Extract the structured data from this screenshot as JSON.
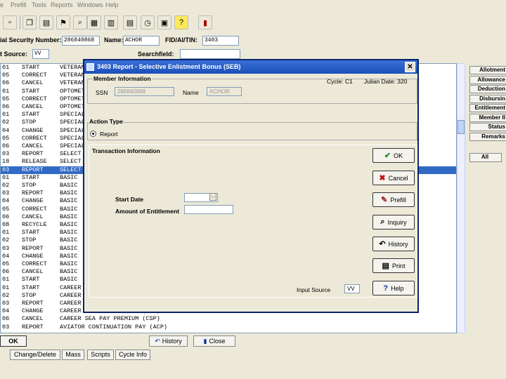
{
  "menu": [
    "e",
    "Prefill",
    "Tools",
    "Reports",
    "Windows",
    "Help"
  ],
  "toolbar_icons": [
    "new-icon",
    "copy-icon",
    "paste-icon",
    "flag-icon",
    "find-icon",
    "calculator-icon",
    "report-icon",
    "clock-icon",
    "help-icon",
    "exit-icon"
  ],
  "fields": {
    "ssn_label": "ial Security Number:",
    "ssn_value": "286840868",
    "name_label": "Name:",
    "name_value": "ACHOR",
    "fid_label": "FID/AI/TIN:",
    "fid_value": "3403",
    "input_source_label": "t Source:",
    "input_source_value": "VV",
    "searchfield_label": "Searchfield:",
    "searchfield_value": ""
  },
  "rows": [
    {
      "c1": "01",
      "c2": "START",
      "c3": "VETERAN"
    },
    {
      "c1": "05",
      "c2": "CORRECT",
      "c3": "VETERAN"
    },
    {
      "c1": "06",
      "c2": "CANCEL",
      "c3": "VETERAN"
    },
    {
      "c1": "01",
      "c2": "START",
      "c3": "OPTOMETRIST"
    },
    {
      "c1": "05",
      "c2": "CORRECT",
      "c3": "OPTOMETRIST"
    },
    {
      "c1": "06",
      "c2": "CANCEL",
      "c3": "OPTOMETRIST"
    },
    {
      "c1": "01",
      "c2": "START",
      "c3": "SPECIAL"
    },
    {
      "c1": "02",
      "c2": "STOP",
      "c3": "SPECIAL"
    },
    {
      "c1": "04",
      "c2": "CHANGE",
      "c3": "SPECIAL"
    },
    {
      "c1": "05",
      "c2": "CORRECT",
      "c3": "SPECIAL"
    },
    {
      "c1": "06",
      "c2": "CANCEL",
      "c3": "SPECIAL"
    },
    {
      "c1": "03",
      "c2": "REPORT",
      "c3": "SELECT"
    },
    {
      "c1": "18",
      "c2": "RELEASE",
      "c3": "SELECT"
    },
    {
      "c1": "03",
      "c2": "REPORT",
      "c3": "SELECT"
    },
    {
      "c1": "01",
      "c2": "START",
      "c3": "BASIC"
    },
    {
      "c1": "02",
      "c2": "STOP",
      "c3": "BASIC"
    },
    {
      "c1": "03",
      "c2": "REPORT",
      "c3": "BASIC"
    },
    {
      "c1": "04",
      "c2": "CHANGE",
      "c3": "BASIC"
    },
    {
      "c1": "05",
      "c2": "CORRECT",
      "c3": "BASIC"
    },
    {
      "c1": "06",
      "c2": "CANCEL",
      "c3": "BASIC"
    },
    {
      "c1": "08",
      "c2": "RECYCLE",
      "c3": "BASIC"
    },
    {
      "c1": "01",
      "c2": "START",
      "c3": "BASIC"
    },
    {
      "c1": "02",
      "c2": "STOP",
      "c3": "BASIC"
    },
    {
      "c1": "03",
      "c2": "REPORT",
      "c3": "BASIC"
    },
    {
      "c1": "04",
      "c2": "CHANGE",
      "c3": "BASIC"
    },
    {
      "c1": "05",
      "c2": "CORRECT",
      "c3": "BASIC"
    },
    {
      "c1": "06",
      "c2": "CANCEL",
      "c3": "BASIC"
    },
    {
      "c1": "01",
      "c2": "START",
      "c3": "BASIC"
    },
    {
      "c1": "01",
      "c2": "START",
      "c3": "CAREER"
    },
    {
      "c1": "02",
      "c2": "STOP",
      "c3": "CAREER"
    },
    {
      "c1": "03",
      "c2": "REPORT",
      "c3": "CAREER"
    },
    {
      "c1": "04",
      "c2": "CHANGE",
      "c3": "CAREER SEA PAY PREMIUM (CSP)"
    },
    {
      "c1": "06",
      "c2": "CANCEL",
      "c3": "CAREER SEA PAY PREMIUM (CSP)"
    },
    {
      "c1": "03",
      "c2": "REPORT",
      "c3": "AVIATOR CONTINUATION PAY (ACP)"
    }
  ],
  "selected_row_index": 13,
  "right_panel": [
    "Allotment",
    "Allowance",
    "Deduction",
    "Disbursin",
    "Entitlement",
    "Member II",
    "Status",
    "Remarks",
    "All"
  ],
  "bottom": {
    "ok_label": "OK",
    "history_label": "History",
    "close_label": "Close",
    "tabs": [
      "Change/Delete",
      "Mass",
      "Scripts",
      "Cycle Info"
    ]
  },
  "dialog": {
    "title": "3403  Report - Selective Enlistment Bonus (SEB)",
    "close_glyph": "✕",
    "member_info_title": "Member Information",
    "cycle": "Cycle: C1",
    "julian": "Julian Date: 320",
    "ssn_label": "SSN",
    "ssn_value": "286840868",
    "name_label": "Name",
    "name_value": "ACHOR",
    "action_type_title": "Action Type",
    "action_report_label": "Report",
    "transaction_title": "Transaction Information",
    "start_date_label": "Start Date",
    "start_date_value": "",
    "start_date_btn": "...",
    "amount_label": "Amount of Entitlement",
    "amount_value": "",
    "input_source_label": "Input Source",
    "input_source_value": "VV",
    "buttons": {
      "ok": "OK",
      "cancel": "Cancel",
      "prefill": "Prefill",
      "inquiry": "Inquiry",
      "history": "History",
      "print": "Print",
      "help": "Help"
    },
    "button_colors": {
      "ok": "#1a8a1a",
      "cancel": "#c01010",
      "help": "#1030a0"
    }
  }
}
